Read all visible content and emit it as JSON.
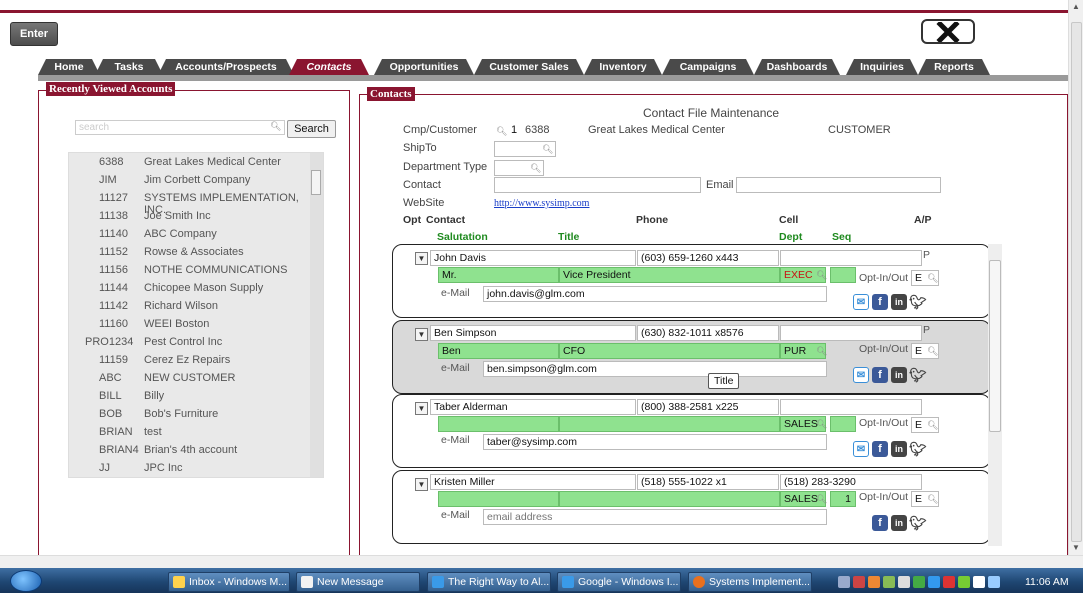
{
  "toolbar": {
    "enter_label": "Enter",
    "close_icon": "close-icon"
  },
  "tabs": [
    {
      "label": "Home"
    },
    {
      "label": "Tasks"
    },
    {
      "label": "Accounts/Prospects"
    },
    {
      "label": "Contacts",
      "active": true
    },
    {
      "label": "Opportunities"
    },
    {
      "label": "Customer Sales"
    },
    {
      "label": "Inventory"
    },
    {
      "label": "Campaigns"
    },
    {
      "label": "Dashboards"
    },
    {
      "label": "Inquiries"
    },
    {
      "label": "Reports"
    }
  ],
  "recent": {
    "title": "Recently Viewed Accounts",
    "search_placeholder": "search",
    "search_button": "Search",
    "items": [
      {
        "code": "6388",
        "name": "Great Lakes Medical Center"
      },
      {
        "code": "JIM",
        "name": "Jim Corbett Company"
      },
      {
        "code": "11127",
        "name": "SYSTEMS IMPLEMENTATION, INC."
      },
      {
        "code": "11138",
        "name": "Joe Smith Inc"
      },
      {
        "code": "11140",
        "name": "ABC Company"
      },
      {
        "code": "11152",
        "name": "Rowse & Associates"
      },
      {
        "code": "11156",
        "name": "NOTHE COMMUNICATIONS"
      },
      {
        "code": "11144",
        "name": "Chicopee Mason Supply"
      },
      {
        "code": "11142",
        "name": "Richard Wilson"
      },
      {
        "code": "11160",
        "name": "WEEI Boston"
      },
      {
        "code": "PRO1234",
        "name": "Pest Control Inc"
      },
      {
        "code": "11159",
        "name": "Cerez Ez Repairs"
      },
      {
        "code": "ABC",
        "name": "NEW CUSTOMER"
      },
      {
        "code": "BILL",
        "name": "Billy"
      },
      {
        "code": "BOB",
        "name": "Bob's Furniture"
      },
      {
        "code": "BRIAN",
        "name": "test"
      },
      {
        "code": "BRIAN4",
        "name": "Brian's 4th account"
      },
      {
        "code": "JJ",
        "name": "JPC Inc"
      }
    ]
  },
  "contacts": {
    "title": "Contacts",
    "form_title": "Contact File Maintenance",
    "labels": {
      "cmp_customer": "Cmp/Customer",
      "shipto": "ShipTo",
      "department_type": "Department Type",
      "contact": "Contact",
      "email": "Email",
      "website": "WebSite"
    },
    "cmp_number": "1",
    "customer_code": "6388",
    "customer_name": "Great Lakes Medical Center",
    "customer_type": "CUSTOMER",
    "website_value": "http://www.sysimp.com",
    "columns": {
      "opt": "Opt",
      "contact": "Contact",
      "phone": "Phone",
      "cell": "Cell",
      "ap": "A/P"
    },
    "subcolumns": {
      "salutation": "Salutation",
      "title": "Title",
      "dept": "Dept",
      "seq": "Seq"
    },
    "email_label": "e-Mail",
    "opt_label": "Opt-In/Out",
    "cards": [
      {
        "name": "John Davis",
        "phone": "(603) 659-1260 x443",
        "cell": "",
        "ap": "P",
        "salutation": "Mr.",
        "title": "Vice President",
        "dept": "EXEC",
        "seq": "",
        "opt": "E",
        "email": "john.davis@glm.com",
        "email_placeholder": ""
      },
      {
        "name": "Ben Simpson",
        "phone": "(630) 832-1011 x8576",
        "cell": "",
        "ap": "P",
        "salutation": "Ben",
        "title": "CFO",
        "dept": "PUR",
        "seq": "",
        "opt": "E",
        "email": "ben.simpson@glm.com",
        "email_placeholder": ""
      },
      {
        "name": "Taber Alderman",
        "phone": "(800) 388-2581 x225",
        "cell": "",
        "ap": "",
        "salutation": "",
        "title": "",
        "dept": "SALES",
        "seq": "",
        "opt": "E",
        "email": "taber@sysimp.com",
        "email_placeholder": ""
      },
      {
        "name": "Kristen Miller",
        "phone": "(518) 555-1022 x1",
        "cell": "(518) 283-3290",
        "ap": "",
        "salutation": "",
        "title": "",
        "dept": "SALES",
        "seq": "1",
        "opt": "E",
        "email": "",
        "email_placeholder": "email address"
      }
    ],
    "tooltip": "Title"
  },
  "taskbar": {
    "items": [
      "Inbox - Windows M...",
      "New Message",
      "The Right Way to Al...",
      "Google - Windows I...",
      "Systems Implement..."
    ],
    "clock": "11:06 AM"
  },
  "colors": {
    "brand": "#8a1530",
    "field_green": "#8fe28f",
    "dark_tab": "#4a4a4a"
  }
}
